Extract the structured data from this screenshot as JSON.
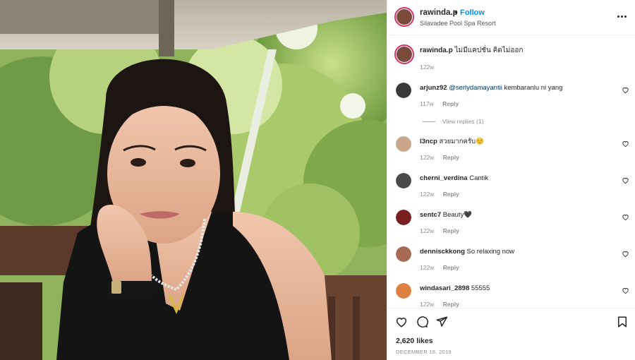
{
  "post": {
    "username": "rawinda.p",
    "dot": "•",
    "follow": "Follow",
    "location": "Silavadee Pool Spa Resort",
    "caption_text": "ไม่มีแคปชั่น คิดไม่ออก",
    "caption_time": "122w",
    "likes": "2,620 likes",
    "date": "DECEMBER 18, 2019"
  },
  "comments": [
    {
      "username": "arjunz92",
      "mention": "@serlydamayantii",
      "text": " kembaranlu ni yang",
      "time": "117w",
      "reply": "Reply",
      "view_replies": "View replies (1)",
      "avatar_color": "#3a3a3a"
    },
    {
      "username": "l3ncp",
      "mention": "",
      "text": " สวยมากครับ☺️",
      "time": "122w",
      "reply": "Reply",
      "view_replies": "",
      "avatar_color": "#c9a58a"
    },
    {
      "username": "cherni_verdina",
      "mention": "",
      "text": " Cantik",
      "time": "122w",
      "reply": "Reply",
      "view_replies": "",
      "avatar_color": "#4a4a4a"
    },
    {
      "username": "sentc7",
      "mention": "",
      "text": " Beauty🖤",
      "time": "122w",
      "reply": "Reply",
      "view_replies": "",
      "avatar_color": "#7a1f1f"
    },
    {
      "username": "dennisckkong",
      "mention": "",
      "text": " So relaxing now",
      "time": "122w",
      "reply": "Reply",
      "view_replies": "",
      "avatar_color": "#a86a55"
    },
    {
      "username": "windasari_2898",
      "mention": "",
      "text": " 55555",
      "time": "122w",
      "reply": "Reply",
      "view_replies": "",
      "avatar_color": "#e08040"
    }
  ],
  "icons": {
    "like": "heart-icon",
    "comment": "comment-icon",
    "share": "share-icon",
    "save": "bookmark-icon",
    "more": "more-options-icon"
  },
  "colors": {
    "follow_blue": "#0095f6",
    "story_ring": "#d6336c",
    "muted": "#8e8e8e"
  }
}
